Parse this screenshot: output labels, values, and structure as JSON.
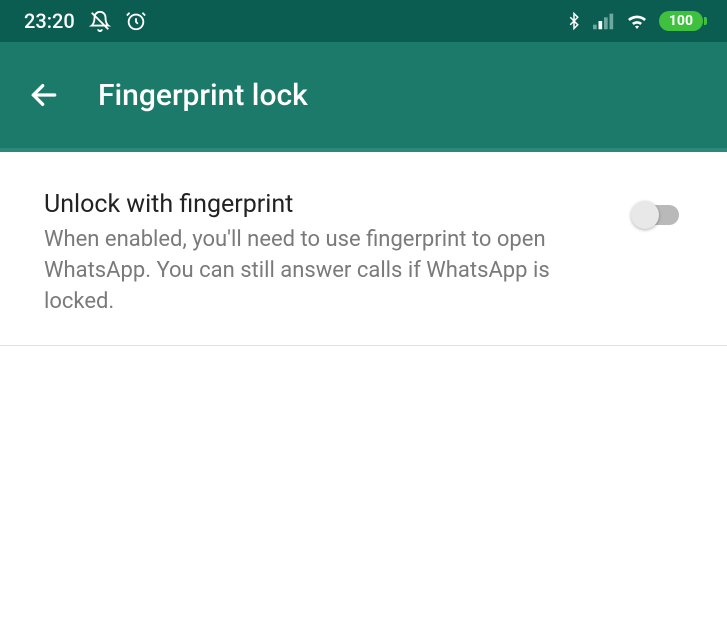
{
  "status_bar": {
    "time": "23:20",
    "battery_level": "100",
    "icons": {
      "mute": "bell-slash-icon",
      "alarm": "alarm-icon",
      "bluetooth": "bluetooth-icon",
      "signal": "signal-icon",
      "wifi": "wifi-icon"
    }
  },
  "app_bar": {
    "title": "Fingerprint lock"
  },
  "setting": {
    "title": "Unlock with fingerprint",
    "description": "When enabled, you'll need to use fingerprint to open WhatsApp. You can still answer calls if WhatsApp is locked.",
    "toggle_state": "off"
  },
  "colors": {
    "status_bg": "#0b5d51",
    "appbar_bg": "#1c7a6a",
    "battery": "#3fc13f"
  }
}
